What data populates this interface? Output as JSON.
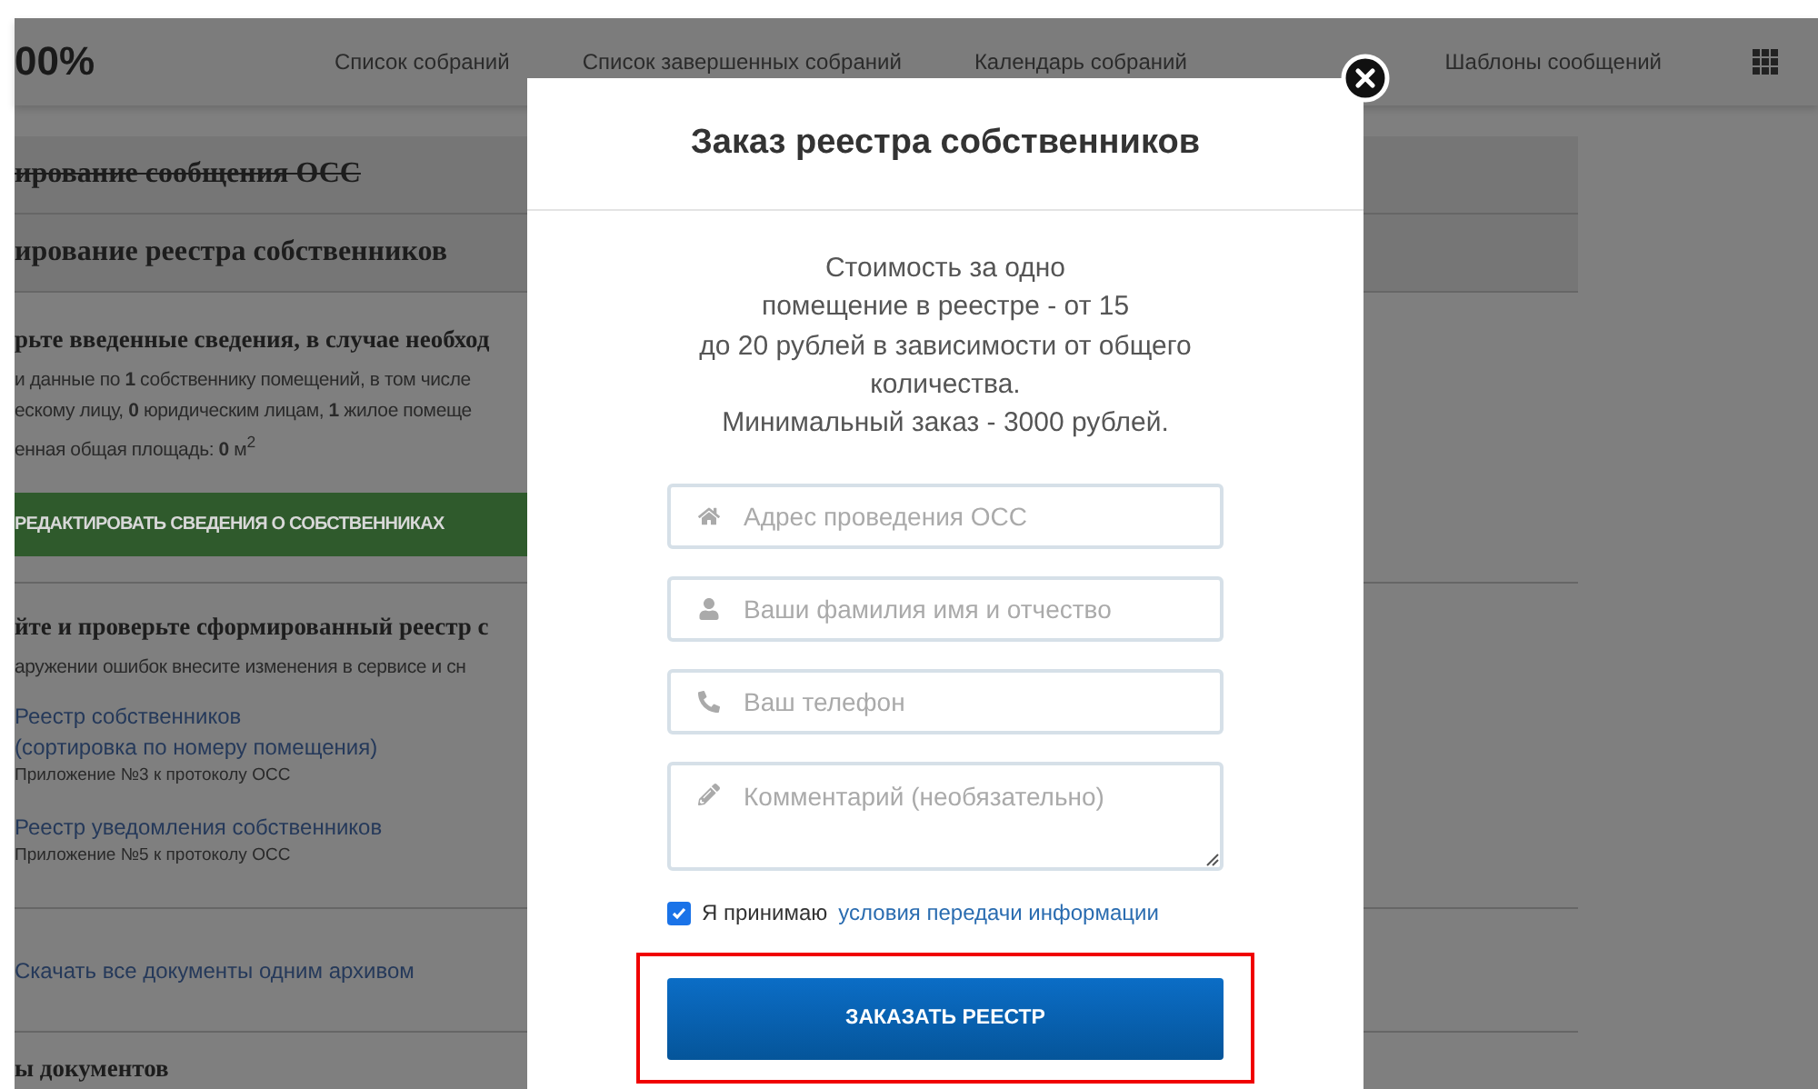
{
  "header": {
    "logo": "00%",
    "nav": [
      "Список собраний",
      "Список завершенных собраний",
      "Календарь собраний",
      "Шаблоны сообщений"
    ]
  },
  "bands": [
    {
      "text": "ирование сообщения ОСС",
      "struck": true
    },
    {
      "text": "ирование реестра собственников",
      "struck": false
    }
  ],
  "owners_check": {
    "title": "рьте введенные сведения, в случае необход",
    "lines": [
      "и данные по **1** собственнику помещений, в том числе",
      "ескому лицу, **0** юридическим лицам, **1** жилое помеще",
      "енная общая площадь: **0** м$^{2}$"
    ],
    "button": "РЕДАКТИРОВАТЬ СВЕДЕНИЯ О СОБСТВЕННИКАХ"
  },
  "registry": {
    "title": "йте и проверьте сформированный реестр с",
    "note": "аружении ошибок внесите изменения в сервисе и сн",
    "documents": [
      {
        "links": [
          "Реестр собственников",
          "(сортировка по номеру помещения)"
        ],
        "caption": "Приложение №3 к протоколу ОСС"
      },
      {
        "links": [
          "Реестр уведомления собственников"
        ],
        "caption": "Приложение №5 к протоколу ОСС"
      }
    ]
  },
  "archive_link": "Скачать все документы одним архивом",
  "next_heading": "ы документов",
  "modal": {
    "title": "Заказ реестра собственников",
    "description": [
      "Стоимость за одно",
      "помещение в реестре - от 15",
      "до 20 рублей в зависимости от общего",
      "количества.",
      "Минимальный заказ - 3000 рублей."
    ],
    "fields": [
      {
        "kind": "input",
        "placeholder": "Адрес проведения ОСС"
      },
      {
        "kind": "input",
        "placeholder": "Ваши фамилия имя и отчество"
      },
      {
        "kind": "input",
        "placeholder": "Ваш телефон"
      },
      {
        "kind": "textarea",
        "placeholder": "Комментарий (необязательно)"
      }
    ],
    "consent": {
      "checked": true,
      "text": "Я принимаю",
      "link": "условия передачи информации"
    },
    "submit": {
      "label": "ЗАКАЗАТЬ РЕЕСТР",
      "highlighted": true
    }
  }
}
